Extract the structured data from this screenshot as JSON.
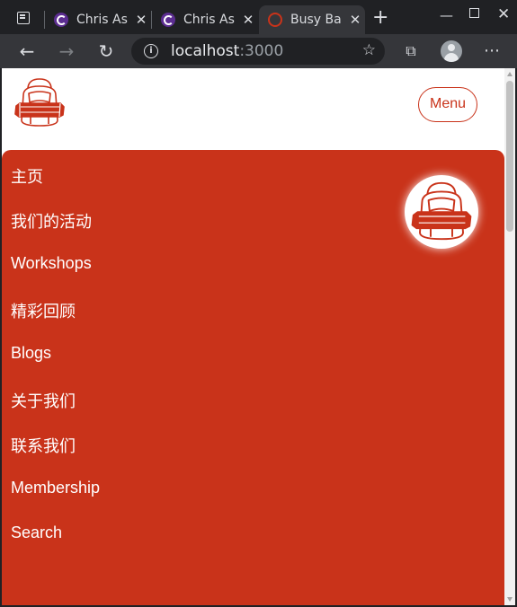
{
  "browser": {
    "tabs": [
      {
        "title": "Chris As",
        "active": false
      },
      {
        "title": "Chris As",
        "active": false
      },
      {
        "title": "Busy Ba",
        "active": true
      }
    ],
    "new_tab_label": "+",
    "address": {
      "host": "localhost",
      "port": ":3000"
    },
    "icons": [
      "window-icon",
      "back-icon",
      "forward-icon",
      "reload-icon",
      "info-icon",
      "favorite-star-icon",
      "collections-icon",
      "profile-avatar",
      "more-icon",
      "minimize-icon",
      "maximize-icon",
      "close-icon"
    ]
  },
  "page": {
    "menu_label": "Menu",
    "nav": [
      {
        "label": "主页"
      },
      {
        "label": "我们的活动"
      },
      {
        "label": "Workshops"
      },
      {
        "label": "精彩回顾"
      },
      {
        "label": "Blogs"
      },
      {
        "label": "关于我们"
      },
      {
        "label": "联系我们"
      },
      {
        "label": "Membership"
      },
      {
        "label": "Search"
      }
    ]
  },
  "colors": {
    "brand": "#c9331a",
    "page_bg": "#ffffff",
    "browser_dark": "#202124",
    "browser_toolbar": "#35363a"
  }
}
